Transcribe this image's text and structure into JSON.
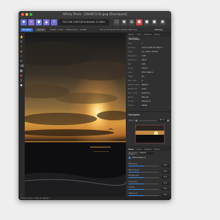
{
  "window": {
    "title": "Affinity Photo - [DSHBF1230 Jpeg (Developed)]",
    "traffic_lights": [
      "#ff5f57",
      "#febc2e",
      "#28c840"
    ]
  },
  "toolbar": {
    "info_text": "ISO 100 1/50 F/8 Unknown 17.00m",
    "icons": [
      "photo-persona-icon",
      "liquify-icon",
      "develop-icon",
      "tone-map-icon",
      "export-icon"
    ]
  },
  "context_toolbar": {
    "left_button": "Develop",
    "cancel_button": "Cancel",
    "info": "RGB8 • DNG • 1632x1224 • 4.8MB",
    "right_text": "Show Soft Proof: No Gamut Warning",
    "chevron": "Overlay"
  },
  "status_bar": {
    "text": "Drag to pan. Click to select."
  },
  "metadata_panel": {
    "tabs": [
      "Basic",
      "Lens",
      "Details",
      "Tones",
      "Overlays"
    ],
    "active_tab": "Basic",
    "header": "Summary",
    "rows": [
      {
        "k": "Title",
        "v": "1"
      },
      {
        "k": "Camera",
        "v": "Canon EOS 5D Mark II"
      },
      {
        "k": "Date",
        "v": "17 / 2012, 09:28"
      },
      {
        "k": "Exposure",
        "v": "1/50"
      },
      {
        "k": "Aperture",
        "v": "F/8.0"
      },
      {
        "k": "ISO",
        "v": "100"
      },
      {
        "k": "Focal",
        "v": "17mm"
      },
      {
        "k": "Lens",
        "v": "EF17-40mm"
      },
      {
        "k": "Flash",
        "v": "No"
      },
      {
        "k": "Exp. bias",
        "v": "0"
      },
      {
        "k": "Meter mode",
        "v": "Pattern"
      },
      {
        "k": "White bal.",
        "v": "Auto"
      },
      {
        "k": "Exp. prog.",
        "v": "Aperture"
      },
      {
        "k": "Mode",
        "v": "Manual"
      },
      {
        "k": "Scene",
        "v": "Standard"
      },
      {
        "k": "Colour",
        "v": "sRGB"
      }
    ]
  },
  "navigator": {
    "title": "Navigator",
    "zoom_label": "Zoom",
    "zoom_value": "31 %"
  },
  "develop_panel": {
    "tabs": [
      "Basic",
      "Lens",
      "Details",
      "Tones",
      "Overlays"
    ],
    "active_tab": "Basic",
    "profile_label": "Profile",
    "profile_value": "Default",
    "white_balance_label": "White Balance",
    "sliders": [
      {
        "label": "Exposure",
        "value": "0 %",
        "fraction": 0.5
      },
      {
        "label": "Black Point",
        "value": "0 %",
        "fraction": 0.35
      },
      {
        "label": "Brightness",
        "value": "0 %",
        "fraction": 0.5
      },
      {
        "label": "Contrast",
        "value": "0 %",
        "fraction": 0.5
      },
      {
        "label": "Clarity",
        "value": "0 %",
        "fraction": 0.5
      },
      {
        "label": "Vibrance",
        "value": "0 %",
        "fraction": 0.5
      }
    ]
  }
}
